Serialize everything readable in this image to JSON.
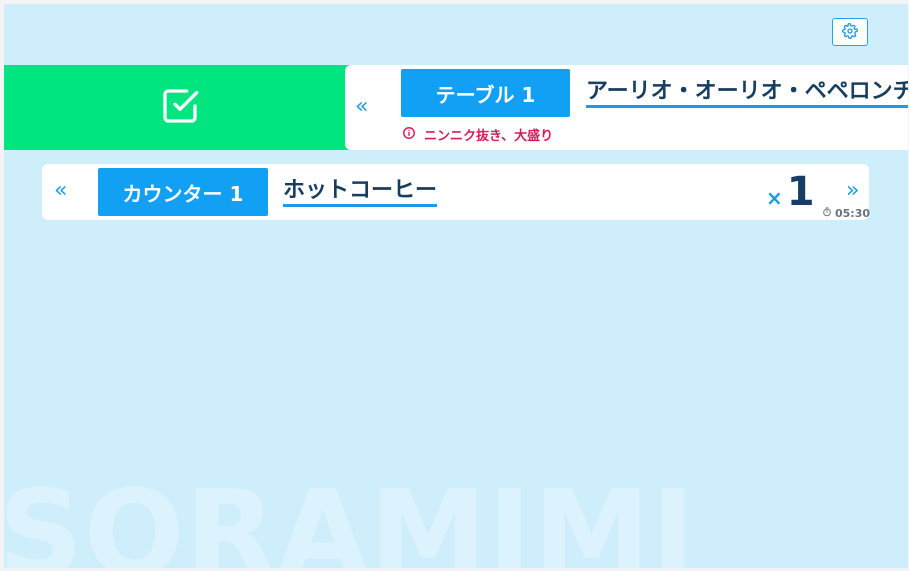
{
  "app": {
    "watermark": "SORAMIMI"
  },
  "header": {
    "settings_icon": "gear-icon"
  },
  "orders": [
    {
      "table_label": "テーブル 1",
      "item_name": "アーリオ・オーリオ・ペペロンチーノ",
      "note": "ニンニク抜き、大盛り",
      "note_icon": "info-icon",
      "swipe_action_icon": "checkbox-check-icon",
      "left_icon": "double-chevron-left-icon"
    },
    {
      "table_label": "カウンター 1",
      "item_name": "ホットコーヒー",
      "qty_prefix": "×",
      "quantity": "1",
      "elapsed_time": "05:30",
      "time_icon": "stopwatch-icon",
      "left_icon": "double-chevron-left-icon",
      "right_icon": "double-chevron-right-icon"
    }
  ],
  "colors": {
    "background": "#cfeefb",
    "accent_blue": "#12a0f5",
    "swipe_green": "#00e57f",
    "note_red": "#d61a5a",
    "text_dark": "#173e61"
  }
}
